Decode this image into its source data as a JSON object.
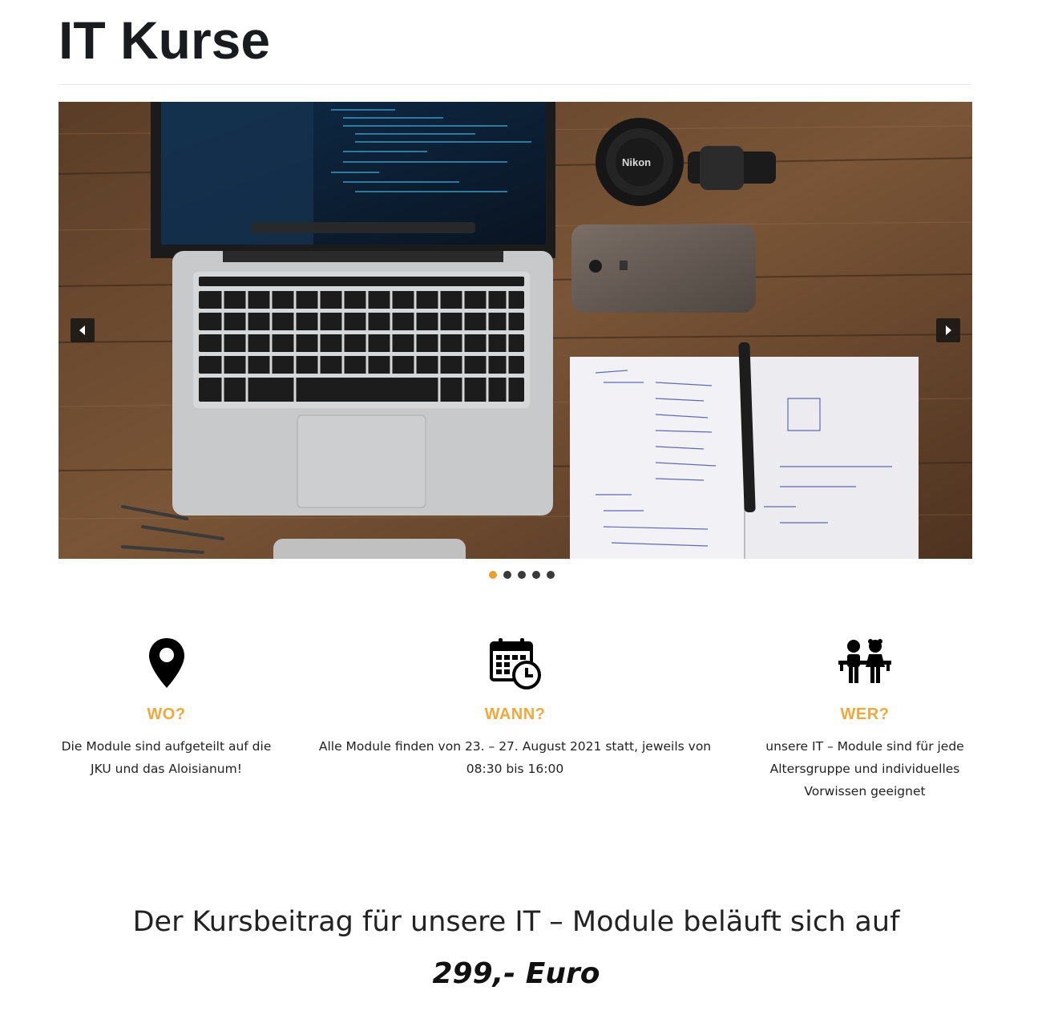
{
  "page": {
    "title": "IT Kurse"
  },
  "slider": {
    "image_subject": "laptop-desk-photo",
    "prev_icon": "caret-left-icon",
    "next_icon": "caret-right-icon",
    "slide_count": 5,
    "active_slide": 1
  },
  "features": [
    {
      "icon": "map-pin-icon",
      "heading": "WO?",
      "text": "Die Module sind aufgeteilt auf die JKU und das Aloisianum!"
    },
    {
      "icon": "calendar-clock-icon",
      "heading": "WANN?",
      "text": "Alle Module finden von 23. – 27. August 2021 statt, jeweils von 08:30 bis 16:00"
    },
    {
      "icon": "kids-group-icon",
      "heading": "WER?",
      "text": "unsere IT – Module sind für jede Altersgruppe und individuelles Vorwissen geeignet"
    }
  ],
  "pricing": {
    "text": "Der Kursbeitrag für unsere IT – Module beläuft sich auf",
    "value": "299,- Euro"
  },
  "colors": {
    "accent": "#f0a83c",
    "active_dot": "#e8a030",
    "dot": "#3a3a3a",
    "title": "#191b1f"
  }
}
